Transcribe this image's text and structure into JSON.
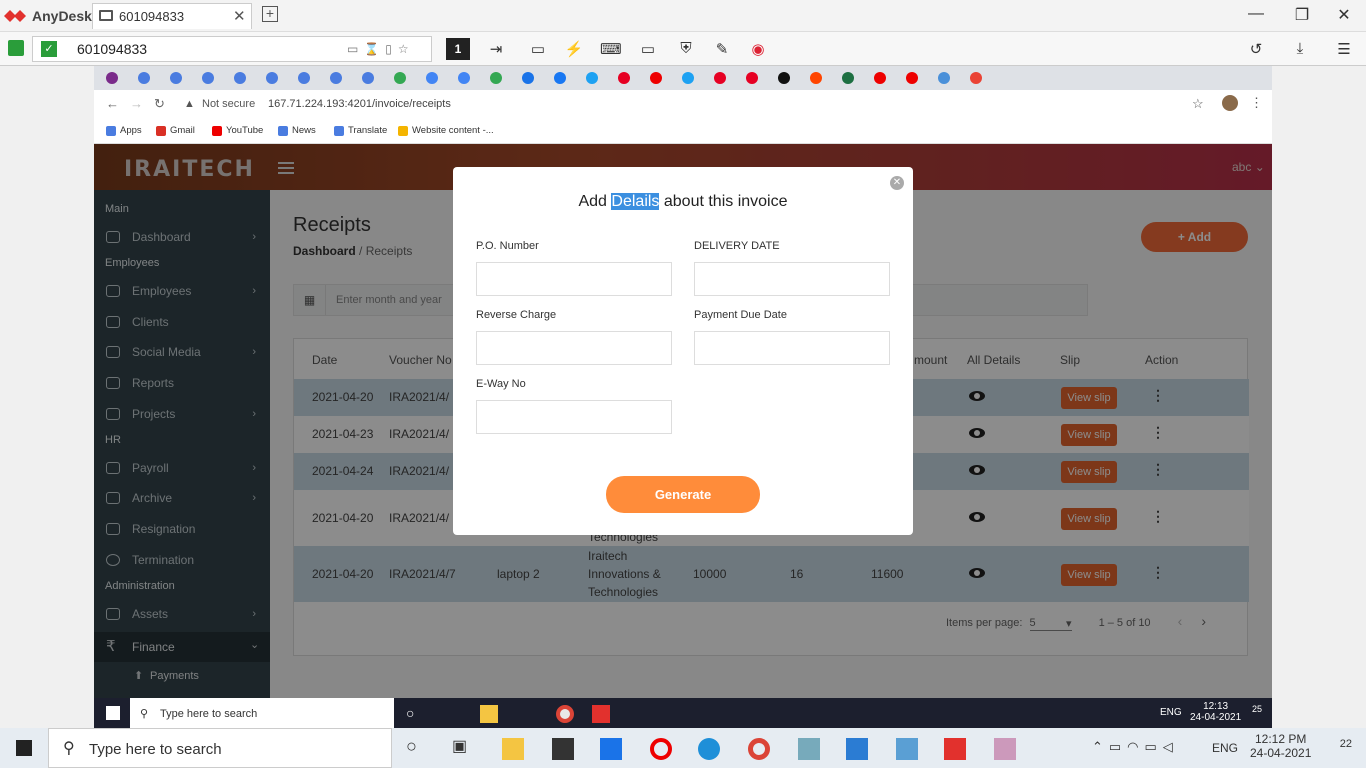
{
  "anydesk": {
    "app_name": "AnyDesk",
    "tab_title": "601094833",
    "address": "601094833",
    "monitor_badge": "1"
  },
  "browser": {
    "security": "Not secure",
    "url": "167.71.224.193:4201/invoice/receipts",
    "bookmarks": [
      "Apps",
      "Gmail",
      "YouTube",
      "News",
      "Translate",
      "Website content -..."
    ]
  },
  "app": {
    "logo": "IRAITECH",
    "user": "abc",
    "page_title": "Receipts",
    "breadcrumb_home": "Dashboard",
    "breadcrumb_sep": "/",
    "breadcrumb_current": "Receipts",
    "add_label": "+ Add",
    "date_placeholder": "Enter month and year",
    "sidebar": {
      "sec_main": "Main",
      "dashboard": "Dashboard",
      "sec_employees": "Employees",
      "employees": "Employees",
      "clients": "Clients",
      "social": "Social Media",
      "reports": "Reports",
      "projects": "Projects",
      "sec_hr": "HR",
      "payroll": "Payroll",
      "archive": "Archive",
      "resignation": "Resignation",
      "termination": "Termination",
      "sec_admin": "Administration",
      "assets": "Assets",
      "finance": "Finance",
      "payments": "Payments"
    },
    "table": {
      "headers": {
        "date": "Date",
        "voucher": "Voucher No",
        "amount": "mount",
        "details": "All Details",
        "slip": "Slip",
        "action": "Action"
      },
      "rows": [
        {
          "date": "2021-04-20",
          "voucher": "IRA2021/4/"
        },
        {
          "date": "2021-04-23",
          "voucher": "IRA2021/4/"
        },
        {
          "date": "2021-04-24",
          "voucher": "IRA2021/4/"
        },
        {
          "date": "2021-04-20",
          "voucher": "IRA2021/4/",
          "client_tail": "Technologies"
        },
        {
          "date": "2021-04-20",
          "voucher": "IRA2021/4/7",
          "item": "laptop 2",
          "client1": "Iraitech",
          "client2": "Innovations &",
          "client3": "Technologies",
          "amount": "10000",
          "tax": "16",
          "total": "11600"
        }
      ],
      "slip_label": "View slip"
    },
    "pager": {
      "items_label": "Items per page:",
      "per_page": "5",
      "range": "1 – 5 of 10"
    }
  },
  "modal": {
    "title_pre": "Add ",
    "title_hl": "Delails",
    "title_post": " about this invoice",
    "po_label": "P.O. Number",
    "delivery_label": "DELIVERY DATE",
    "reverse_label": "Reverse Charge",
    "payment_label": "Payment Due Date",
    "eway_label": "E-Way No",
    "generate_label": "Generate"
  },
  "remote_taskbar": {
    "search": "Type here to search",
    "time": "12:13",
    "date": "24-04-2021",
    "lang": "ENG",
    "badge": "25"
  },
  "local_taskbar": {
    "search": "Type here to search",
    "time": "12:12 PM",
    "date": "24-04-2021",
    "lang": "ENG",
    "badge": "22"
  }
}
